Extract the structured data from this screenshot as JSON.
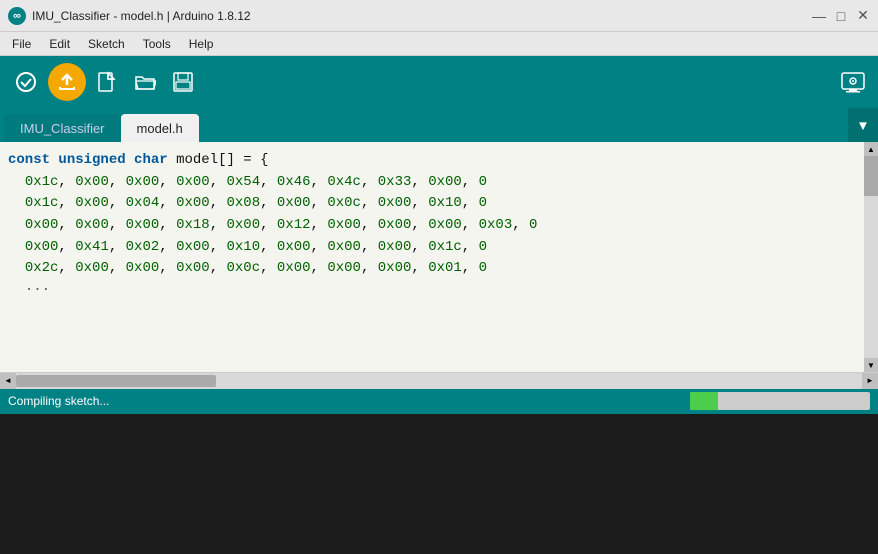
{
  "titlebar": {
    "title": "IMU_Classifier - model.h | Arduino 1.8.12",
    "controls": {
      "minimize": "—",
      "maximize": "□",
      "close": "✕"
    }
  },
  "menubar": {
    "items": [
      "File",
      "Edit",
      "Sketch",
      "Tools",
      "Help"
    ]
  },
  "toolbar": {
    "verify_title": "Verify",
    "upload_title": "Upload",
    "new_title": "New",
    "open_title": "Open",
    "save_title": "Save",
    "serial_title": "Serial Monitor"
  },
  "tabs": {
    "items": [
      {
        "label": "IMU_Classifier",
        "active": false
      },
      {
        "label": "model.h",
        "active": true
      }
    ]
  },
  "code": {
    "lines": [
      "const unsigned char model[] = {",
      "  0x1c, 0x00, 0x00, 0x00, 0x54, 0x46, 0x4c, 0x33, 0x00, 0",
      "  0x1c, 0x00, 0x04, 0x00, 0x08, 0x00, 0x0c, 0x00, 0x10, 0",
      "  0x00, 0x00, 0x00, 0x18, 0x00, 0x12, 0x00, 0x00, 0x00, 0x03, 0",
      "  0x00, 0x41, 0x02, 0x00, 0x10, 0x00, 0x00, 0x00, 0x1c, 0",
      "  0x2c, 0x00, 0x00, 0x00, 0x0c, 0x00, 0x00, 0x00, 0x01, 0"
    ]
  },
  "statusbar": {
    "text": "Compiling sketch...",
    "progress_percent": 16
  },
  "scrollbars": {
    "up_arrow": "▲",
    "down_arrow": "▼",
    "left_arrow": "◄",
    "right_arrow": "►"
  }
}
